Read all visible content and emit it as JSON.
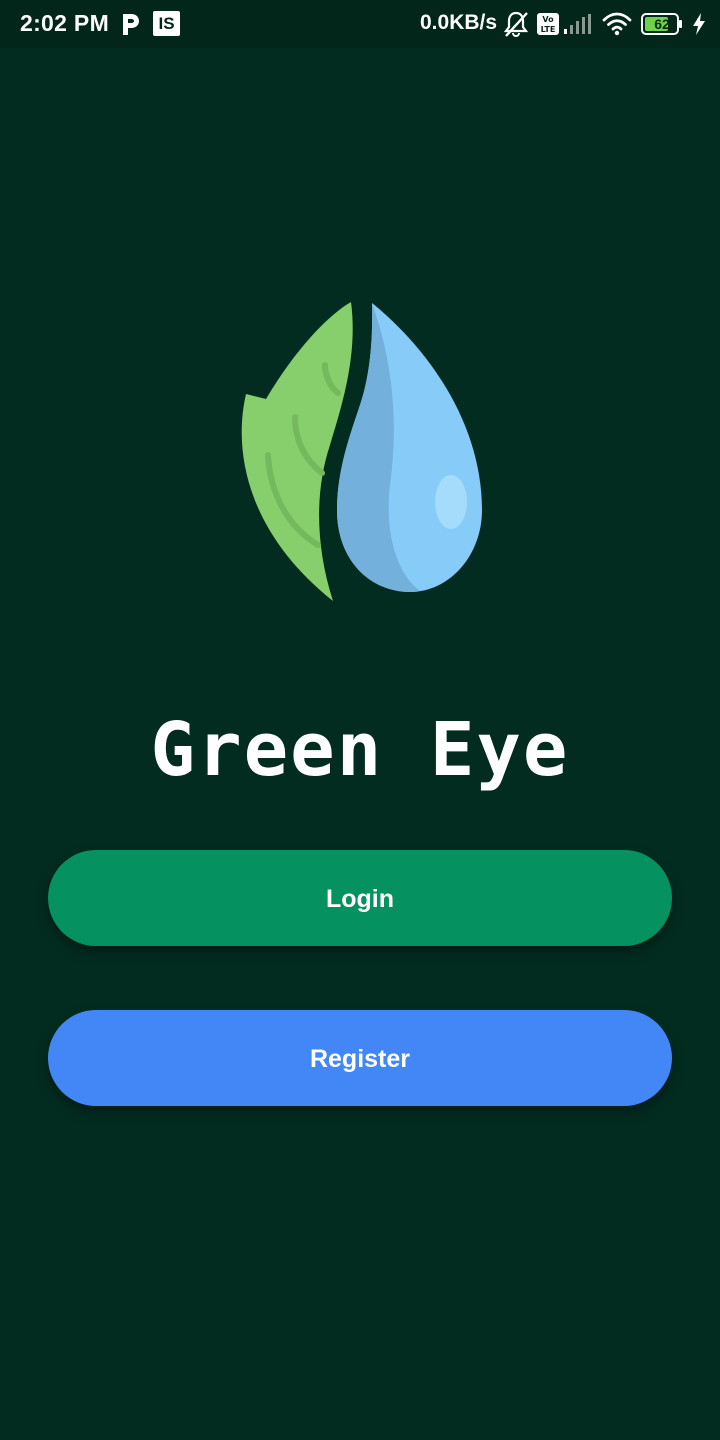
{
  "status_bar": {
    "time": "2:02 PM",
    "notif_is": "IS",
    "net_speed": "0.0KB/s",
    "battery_level": "62",
    "icons": [
      "parking-icon",
      "is-app-icon",
      "muted-bell-icon",
      "volte-icon",
      "signal-icon",
      "wifi-icon",
      "battery-icon",
      "charging-icon"
    ]
  },
  "app": {
    "title": "Green Eye",
    "logo": "leaf-water-drop-logo"
  },
  "actions": {
    "login_label": "Login",
    "register_label": "Register"
  },
  "colors": {
    "background": "#032c20",
    "status_bar": "#022619",
    "login_button": "#069260",
    "register_button": "#4287f5",
    "leaf": "#86cf6c",
    "drop": "#87cbf8",
    "drop_shade": "#73b0dc"
  }
}
